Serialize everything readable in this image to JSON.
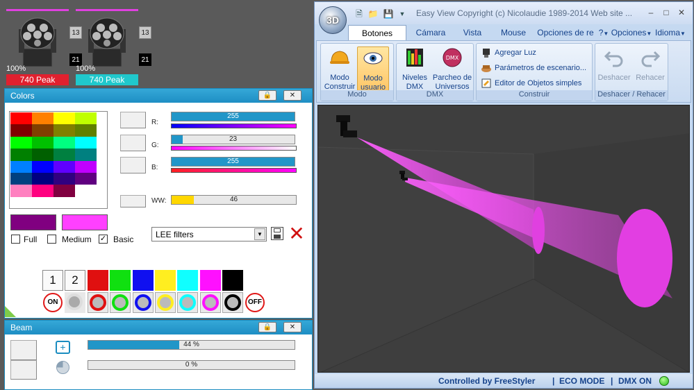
{
  "fixtures": [
    {
      "channel_top": "13",
      "channel_bottom": "21",
      "level": "100%",
      "name": "740 Peak",
      "name_color": "#e0202e"
    },
    {
      "channel_top": "13",
      "channel_bottom": "21",
      "level": "100%",
      "name": "740 Peak",
      "name_color": "#20c8cc"
    }
  ],
  "colors_panel": {
    "title": "Colors",
    "palette": [
      [
        "#ff0000",
        "#ff8000",
        "#ffff00",
        "#c0ff00"
      ],
      [
        "#800000",
        "#804000",
        "#808000",
        "#608000"
      ],
      [
        "#00ff00",
        "#00c000",
        "#00ff80",
        "#00ffff"
      ],
      [
        "#008000",
        "#006000",
        "#008040",
        "#008080"
      ],
      [
        "#0080ff",
        "#0000ff",
        "#6000ff",
        "#c000ff"
      ],
      [
        "#004080",
        "#000080",
        "#300080",
        "#600080"
      ],
      [
        "#ff80c0",
        "#ff0080",
        "#800040",
        "#ffffff"
      ]
    ],
    "current_color_dark": "#800080",
    "current_color": "#ff40ff",
    "channels": [
      {
        "label": "R:",
        "value": "255",
        "percent": 100
      },
      {
        "label": "G:",
        "value": "23",
        "percent": 9
      },
      {
        "label": "B:",
        "value": "255",
        "percent": 100
      }
    ],
    "ww": {
      "label": "WW:",
      "value": "46",
      "percent": 18
    },
    "checkboxes": [
      {
        "label": "Full",
        "checked": false
      },
      {
        "label": "Medium",
        "checked": false
      },
      {
        "label": "Basic",
        "checked": true
      }
    ],
    "filter_select": "LEE filters",
    "number_buttons": [
      "1",
      "2"
    ],
    "color_buttons": [
      "#e01010",
      "#10e010",
      "#1010f0",
      "#ffee20",
      "#10ffff",
      "#ff10ff",
      "#000000"
    ],
    "on_label": "ON",
    "off_label": "OFF"
  },
  "beam_panel": {
    "title": "Beam",
    "zoom": {
      "value": "44 %",
      "percent": 44
    },
    "second": {
      "value": "0 %",
      "percent": 0
    }
  },
  "easy_view": {
    "title": "Easy View   Copyright (c) Nicolaudie 1989-2014    Web site ...",
    "orb_label": "3D",
    "tabs": [
      "Botones estánd",
      "Cámara",
      "Vista",
      "Mouse",
      "Opciones de re"
    ],
    "tabs_right": [
      "?",
      "Opciones",
      "Idioma"
    ],
    "groups": {
      "modo": {
        "name": "Modo",
        "build": "Modo\nConstruir",
        "user": "Modo\nusuario"
      },
      "dmx": {
        "name": "DMX",
        "levels": "Niveles\nDMX",
        "patch": "Parcheo de\nUniversos"
      },
      "construir": {
        "name": "Construir",
        "add": "Agregar Luz",
        "params": "Parámetros de escenario...",
        "editor": "Editor de Objetos simples"
      },
      "undo": {
        "name": "Deshacer / Rehacer",
        "undo": "Deshacer",
        "redo": "Rehacer"
      }
    },
    "status": {
      "controlled": "Controlled by FreeStyler",
      "eco": "ECO MODE",
      "dmx": "DMX ON",
      "sep": "|"
    }
  }
}
